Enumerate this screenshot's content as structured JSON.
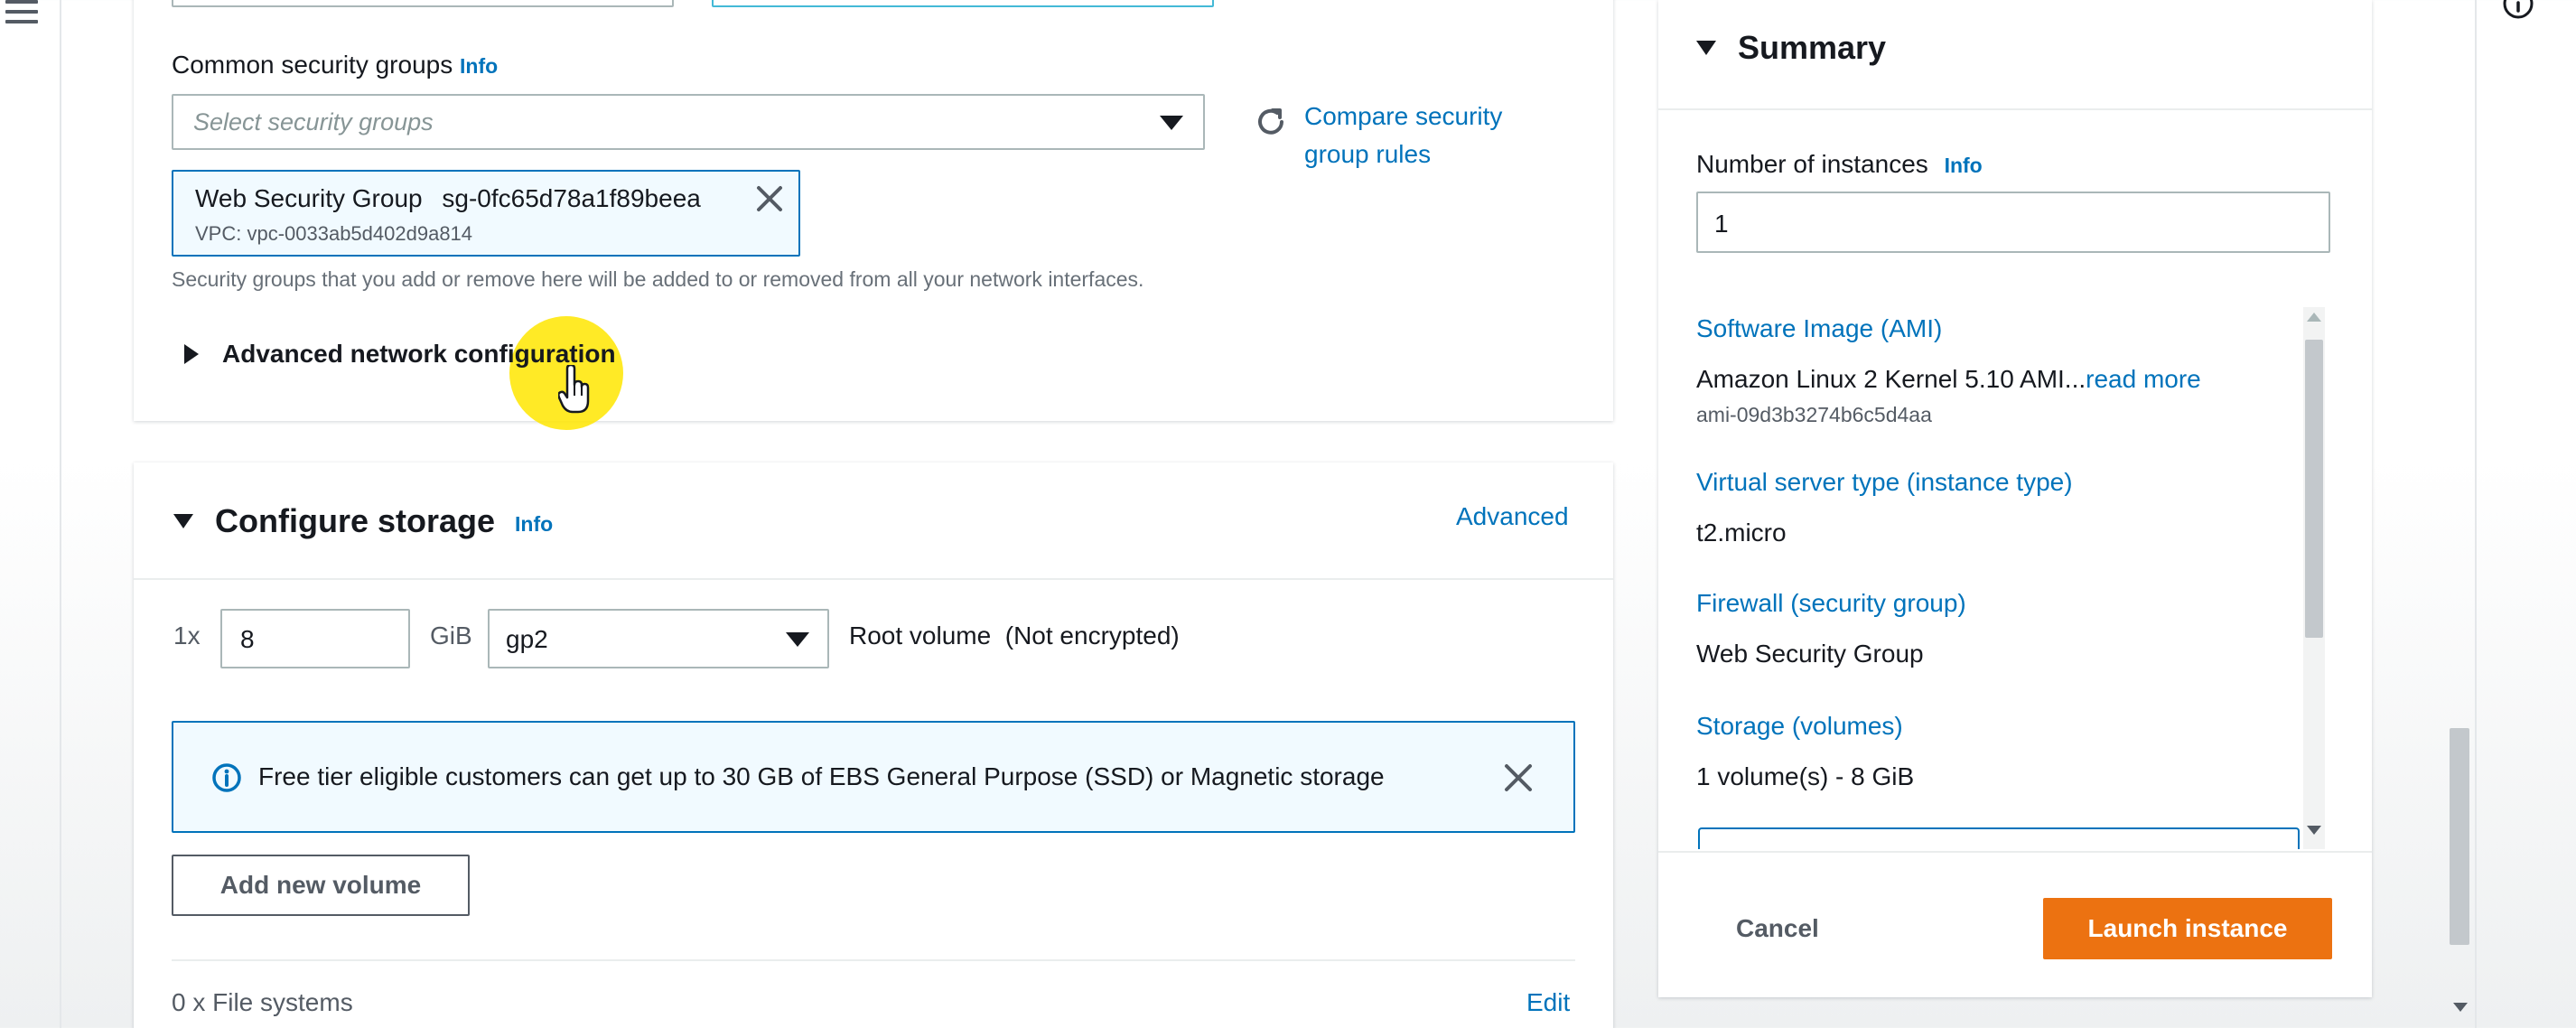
{
  "network": {
    "common_sg_label": "Common security groups",
    "info": "Info",
    "select_placeholder": "Select security groups",
    "compare_link_line1": "Compare security",
    "compare_link_line2": "group rules",
    "token_name": "Web Security Group",
    "token_id": "sg-0fc65d78a1f89beea",
    "token_vpc": "VPC: vpc-0033ab5d402d9a814",
    "help_text": "Security groups that you add or remove here will be added to or removed from all your network interfaces.",
    "advanced_network_label": "Advanced network configuration"
  },
  "storage": {
    "title": "Configure storage",
    "info": "Info",
    "advanced_link": "Advanced",
    "count_label": "1x",
    "size_value": "8",
    "unit_label": "GiB",
    "volume_type": "gp2",
    "root_label": "Root volume  (Not encrypted)",
    "alert_text": "Free tier eligible customers can get up to 30 GB of EBS General Purpose (SSD) or Magnetic storage",
    "add_volume_label": "Add new volume",
    "file_systems_label": "0 x File systems",
    "edit_link": "Edit"
  },
  "summary": {
    "title": "Summary",
    "instances_label": "Number of instances",
    "info": "Info",
    "instances_value": "1",
    "ami_label": "Software Image (AMI)",
    "ami_value": "Amazon Linux 2 Kernel 5.10 AMI...",
    "ami_read_more": "read more",
    "ami_id": "ami-09d3b3274b6c5d4aa",
    "type_label": "Virtual server type (instance type)",
    "type_value": "t2.micro",
    "firewall_label": "Firewall (security group)",
    "firewall_value": "Web Security Group",
    "storage_label": "Storage (volumes)",
    "storage_value": "1 volume(s) - 8 GiB",
    "cancel_label": "Cancel",
    "launch_label": "Launch instance"
  },
  "colors": {
    "link": "#0073bb",
    "primary_button": "#ec7211",
    "token_border": "#0073bb",
    "alert_bg": "#f1faff",
    "cursor_highlight": "#ffe600"
  },
  "icons": [
    "menu-icon",
    "refresh-icon",
    "close-icon",
    "info-circle-icon",
    "caret-down-icon",
    "caret-right-icon",
    "hand-cursor-icon"
  ]
}
